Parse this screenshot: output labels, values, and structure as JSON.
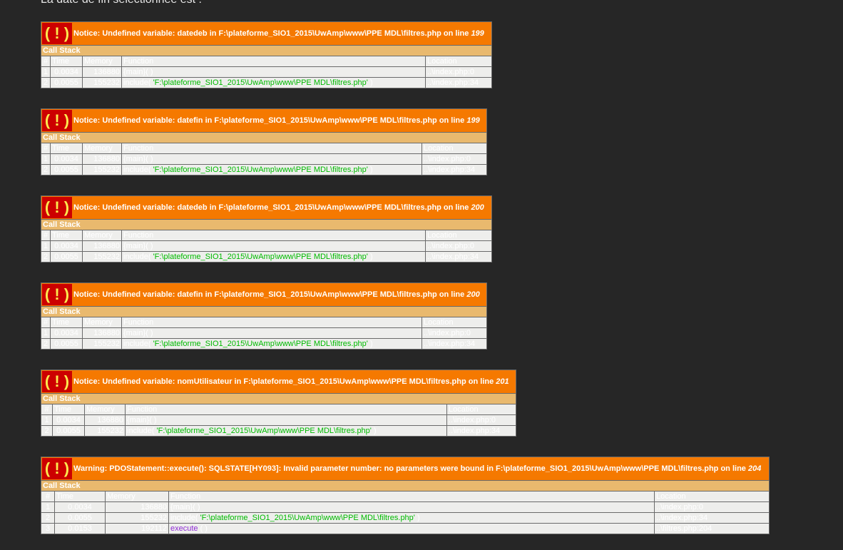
{
  "top_text": "La date de fin sélectionnée est :",
  "icons": {
    "error": "exclamation-icon"
  },
  "colors": {
    "page_bg": "#262626",
    "error_bar": "#f57900",
    "bang_bg": "#cc0000",
    "bang_fg": "#fce94f",
    "callstack_bar": "#e9b96e",
    "row_bg": "#eeeeec",
    "string_arg": "#00bb00",
    "function_name": "#8f2cd6"
  },
  "errors": [
    {
      "bang": "( ! )",
      "message": "Notice: Undefined variable: datedeb in F:\\plateforme_SIO1_2015\\UwAmp\\www\\PPE MDL\\filtres.php on line ",
      "line": "199",
      "call_stack_label": "Call Stack",
      "headers": {
        "num": "#",
        "time": "Time",
        "memory": "Memory",
        "function": "Function",
        "location": "Location"
      },
      "rows": [
        {
          "num": "1",
          "time": "0.0034",
          "memory": "136880",
          "function": "{main}( )",
          "arg": "",
          "fn_close": "",
          "location": "..\\index.php:0"
        },
        {
          "num": "2",
          "time": "0.0055",
          "memory": "155232",
          "function": "include( ",
          "arg": "'F:\\plateforme_SIO1_2015\\UwAmp\\www\\PPE MDL\\filtres.php'",
          "fn_close": " )",
          "location": "..\\index.php:34"
        }
      ]
    },
    {
      "bang": "( ! )",
      "message": "Notice: Undefined variable: datefin in F:\\plateforme_SIO1_2015\\UwAmp\\www\\PPE MDL\\filtres.php on line ",
      "line": "199",
      "call_stack_label": "Call Stack",
      "headers": {
        "num": "#",
        "time": "Time",
        "memory": "Memory",
        "function": "Function",
        "location": "Location"
      },
      "rows": [
        {
          "num": "1",
          "time": "0.0034",
          "memory": "136880",
          "function": "{main}( )",
          "arg": "",
          "fn_close": "",
          "location": "..\\index.php:0"
        },
        {
          "num": "2",
          "time": "0.0055",
          "memory": "155232",
          "function": "include( ",
          "arg": "'F:\\plateforme_SIO1_2015\\UwAmp\\www\\PPE MDL\\filtres.php'",
          "fn_close": " )",
          "location": "..\\index.php:34"
        }
      ]
    },
    {
      "bang": "( ! )",
      "message": "Notice: Undefined variable: datedeb in F:\\plateforme_SIO1_2015\\UwAmp\\www\\PPE MDL\\filtres.php on line ",
      "line": "200",
      "call_stack_label": "Call Stack",
      "headers": {
        "num": "#",
        "time": "Time",
        "memory": "Memory",
        "function": "Function",
        "location": "Location"
      },
      "rows": [
        {
          "num": "1",
          "time": "0.0034",
          "memory": "136880",
          "function": "{main}( )",
          "arg": "",
          "fn_close": "",
          "location": "..\\index.php:0"
        },
        {
          "num": "2",
          "time": "0.0055",
          "memory": "155232",
          "function": "include( ",
          "arg": "'F:\\plateforme_SIO1_2015\\UwAmp\\www\\PPE MDL\\filtres.php'",
          "fn_close": " )",
          "location": "..\\index.php:34"
        }
      ]
    },
    {
      "bang": "( ! )",
      "message": "Notice: Undefined variable: datefin in F:\\plateforme_SIO1_2015\\UwAmp\\www\\PPE MDL\\filtres.php on line ",
      "line": "200",
      "call_stack_label": "Call Stack",
      "headers": {
        "num": "#",
        "time": "Time",
        "memory": "Memory",
        "function": "Function",
        "location": "Location"
      },
      "rows": [
        {
          "num": "1",
          "time": "0.0034",
          "memory": "136880",
          "function": "{main}( )",
          "arg": "",
          "fn_close": "",
          "location": "..\\index.php:0"
        },
        {
          "num": "2",
          "time": "0.0055",
          "memory": "155232",
          "function": "include( ",
          "arg": "'F:\\plateforme_SIO1_2015\\UwAmp\\www\\PPE MDL\\filtres.php'",
          "fn_close": " )",
          "location": "..\\index.php:34"
        }
      ]
    },
    {
      "bang": "( ! )",
      "message": "Notice: Undefined variable: nomUtilisateur in F:\\plateforme_SIO1_2015\\UwAmp\\www\\PPE MDL\\filtres.php on line ",
      "line": "201",
      "call_stack_label": "Call Stack",
      "headers": {
        "num": "#",
        "time": "Time",
        "memory": "Memory",
        "function": "Function",
        "location": "Location"
      },
      "rows": [
        {
          "num": "1",
          "time": "0.0034",
          "memory": "136880",
          "function": "{main}( )",
          "arg": "",
          "fn_close": "",
          "location": "..\\index.php:0"
        },
        {
          "num": "2",
          "time": "0.0055",
          "memory": "155232",
          "function": "include( ",
          "arg": "'F:\\plateforme_SIO1_2015\\UwAmp\\www\\PPE MDL\\filtres.php'",
          "fn_close": " )",
          "location": "..\\index.php:34"
        }
      ]
    },
    {
      "bang": "( ! )",
      "message": "Warning: PDOStatement::execute(): SQLSTATE[HY093]: Invalid parameter number: no parameters were bound in F:\\plateforme_SIO1_2015\\UwAmp\\www\\PPE MDL\\filtres.php on line ",
      "line": "204",
      "call_stack_label": "Call Stack",
      "headers": {
        "num": "#",
        "time": "Time",
        "memory": "Memory",
        "function": "Function",
        "location": "Location"
      },
      "rows": [
        {
          "num": "1",
          "time": "0.0034",
          "memory": "136880",
          "function": "{main}( )",
          "arg": "",
          "fn_close": "",
          "location": "..\\index.php:0"
        },
        {
          "num": "2",
          "time": "0.0055",
          "memory": "155232",
          "function": "include( ",
          "arg": "'F:\\plateforme_SIO1_2015\\UwAmp\\www\\PPE MDL\\filtres.php'",
          "fn_close": " )",
          "location": "..\\index.php:34"
        },
        {
          "num": "3",
          "time": "0.0153",
          "memory": "192112",
          "function": "",
          "exec": "execute",
          "fn_close": " ( )",
          "arg": "",
          "location": "..\\filtres.php:204"
        }
      ]
    }
  ]
}
